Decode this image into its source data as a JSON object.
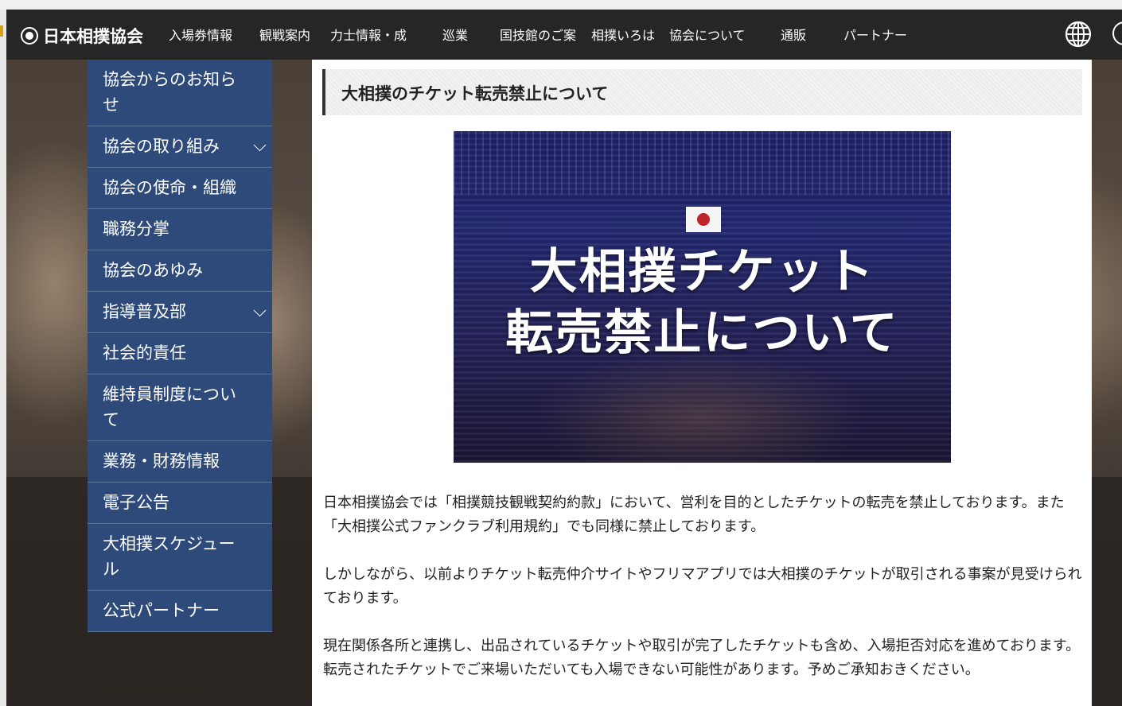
{
  "header": {
    "logo_text": "日本相撲協会",
    "nav": [
      "入場券情報",
      "観戦案内",
      "力士情報・成",
      "巡業",
      "国技館のご案",
      "相撲いろは",
      "協会について",
      "通販",
      "パートナー"
    ]
  },
  "sidebar": {
    "items": [
      {
        "label": "協会からのお知らせ",
        "expandable": false
      },
      {
        "label": "協会の取り組み",
        "expandable": true
      },
      {
        "label": "協会の使命・組織",
        "expandable": false
      },
      {
        "label": "職務分掌",
        "expandable": false
      },
      {
        "label": "協会のあゆみ",
        "expandable": false
      },
      {
        "label": "指導普及部",
        "expandable": true
      },
      {
        "label": "社会的責任",
        "expandable": false
      },
      {
        "label": "維持員制度について",
        "expandable": false
      },
      {
        "label": "業務・財務情報",
        "expandable": false
      },
      {
        "label": "電子公告",
        "expandable": false
      },
      {
        "label": "大相撲スケジュール",
        "expandable": false
      },
      {
        "label": "公式パートナー",
        "expandable": false
      }
    ]
  },
  "article": {
    "title": "大相撲のチケット転売禁止について",
    "banner_line1": "大相撲チケット",
    "banner_line2": "転売禁止について",
    "paragraphs": [
      "日本相撲協会では「相撲競技観戦契約約款」において、営利を目的としたチケットの転売を禁止しております。また「大相撲公式ファンクラブ利用規約」でも同様に禁止しております。",
      "しかしながら、以前よりチケット転売仲介サイトやフリマアプリでは大相撲のチケットが取引される事案が見受けられております。",
      "現在関係各所と連携し、出品されているチケットや取引が完了したチケットも含め、入場拒否対応を進めております。転売されたチケットでご来場いただいても入場できない可能性があります。予めご承知おきください。"
    ]
  },
  "colors": {
    "header_bg": "#262626",
    "sidebar_bg": "#2d4a7a",
    "banner_bg": "#1c1f66"
  },
  "icons": {
    "globe": "globe-icon",
    "chevron": "chevron-down-icon"
  }
}
